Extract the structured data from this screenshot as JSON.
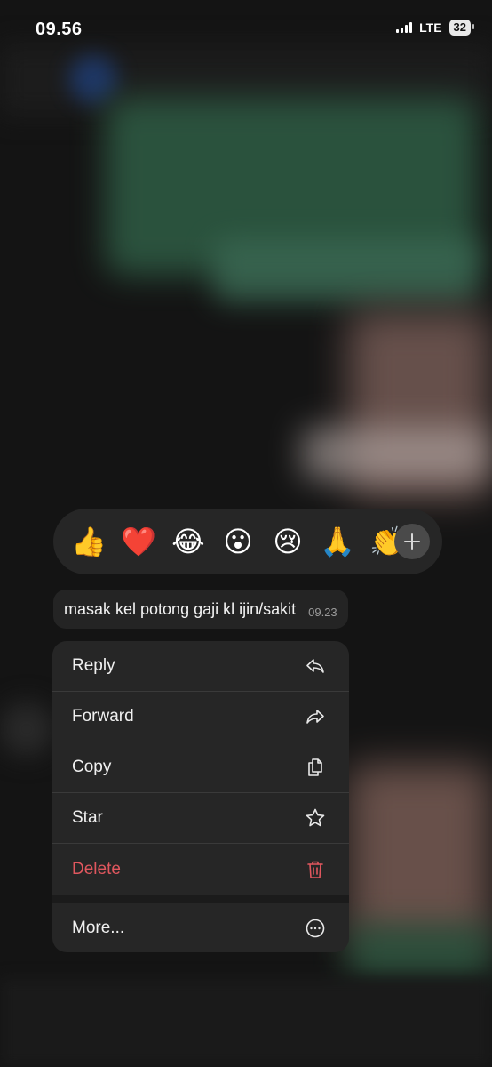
{
  "status_bar": {
    "time": "09.56",
    "network": "LTE",
    "battery": "32"
  },
  "reactions": {
    "emojis": [
      "👍",
      "❤️",
      "😂",
      "😮",
      "😢",
      "🙏",
      "👏"
    ],
    "more_icon": "plus-icon"
  },
  "message": {
    "text": "masak kel potong gaji kl ijin/sakit",
    "time": "09.23"
  },
  "menu": {
    "items": [
      {
        "label": "Reply",
        "icon": "reply-icon"
      },
      {
        "label": "Forward",
        "icon": "forward-icon"
      },
      {
        "label": "Copy",
        "icon": "copy-icon"
      },
      {
        "label": "Star",
        "icon": "star-icon"
      },
      {
        "label": "Delete",
        "icon": "trash-icon"
      }
    ],
    "more": {
      "label": "More...",
      "icon": "ellipsis-circle-icon"
    }
  },
  "colors": {
    "danger": "#e0575e",
    "menu_bg": "#262626",
    "bubble_bg": "#242424"
  }
}
